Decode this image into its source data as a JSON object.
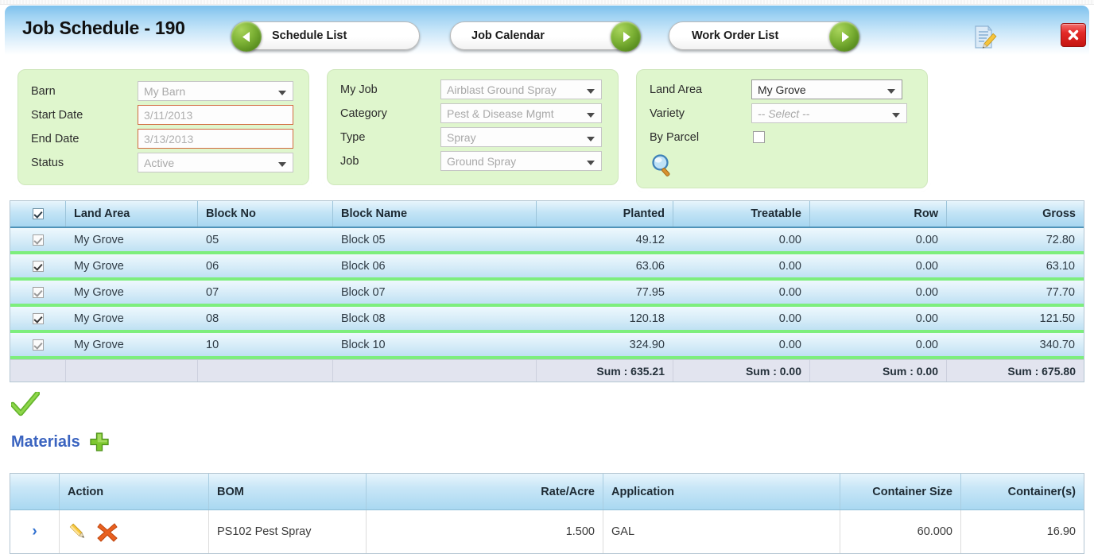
{
  "header": {
    "title": "Job Schedule - 190",
    "nav_buttons": [
      {
        "label": "Schedule List",
        "arrow": "left-arrow-icon"
      },
      {
        "label": "Job Calendar",
        "arrow": "right-arrow-icon"
      },
      {
        "label": "Work Order List",
        "arrow": "right-arrow-icon"
      }
    ],
    "edit_note_icon": "document-pencil-icon",
    "close_icon": "close-x-icon",
    "accent_blue": "#9bd0f2",
    "close_red": "#e32a27"
  },
  "filters": {
    "panel_left": {
      "rows": [
        {
          "label": "Barn",
          "value": "My Barn",
          "control": "select"
        },
        {
          "label": "Start Date",
          "value": "3/11/2013",
          "control": "date"
        },
        {
          "label": "End Date",
          "value": "3/13/2013",
          "control": "date"
        },
        {
          "label": "Status",
          "value": "Active",
          "control": "select"
        }
      ]
    },
    "panel_middle": {
      "rows": [
        {
          "label": "My Job",
          "value": "Airblast Ground Spray",
          "control": "select"
        },
        {
          "label": "Category",
          "value": "Pest & Disease Mgmt",
          "control": "select"
        },
        {
          "label": "Type",
          "value": "Spray",
          "control": "select"
        },
        {
          "label": "Job",
          "value": "Ground Spray",
          "control": "select"
        }
      ]
    },
    "panel_right": {
      "rows": [
        {
          "label": "Land Area",
          "value": "My Grove",
          "control": "select"
        },
        {
          "label": "Variety",
          "value": "-- Select --",
          "control": "select"
        },
        {
          "label": "By Parcel",
          "value": "",
          "control": "checkbox"
        }
      ],
      "search_icon": "magnifier-icon"
    },
    "panel_bg": "#dff6cd"
  },
  "blocks_grid": {
    "columns": [
      "",
      "Land Area",
      "Block No",
      "Block Name",
      "Planted",
      "Treatable",
      "Row",
      "Gross"
    ],
    "rows": [
      {
        "checked": true,
        "land_area": "My Grove",
        "block_no": "05",
        "block_name": "Block 05",
        "planted": "49.12",
        "treatable": "0.00",
        "row": "0.00",
        "gross": "72.80"
      },
      {
        "checked": true,
        "land_area": "My Grove",
        "block_no": "06",
        "block_name": "Block 06",
        "planted": "63.06",
        "treatable": "0.00",
        "row": "0.00",
        "gross": "63.10"
      },
      {
        "checked": true,
        "land_area": "My Grove",
        "block_no": "07",
        "block_name": "Block 07",
        "planted": "77.95",
        "treatable": "0.00",
        "row": "0.00",
        "gross": "77.70"
      },
      {
        "checked": true,
        "land_area": "My Grove",
        "block_no": "08",
        "block_name": "Block 08",
        "planted": "120.18",
        "treatable": "0.00",
        "row": "0.00",
        "gross": "121.50"
      },
      {
        "checked": true,
        "land_area": "My Grove",
        "block_no": "10",
        "block_name": "Block 10",
        "planted": "324.90",
        "treatable": "0.00",
        "row": "0.00",
        "gross": "340.70"
      }
    ],
    "summary": {
      "planted": "Sum : 635.21",
      "treatable": "Sum : 0.00",
      "row": "Sum : 0.00",
      "gross": "Sum : 675.80"
    },
    "row_separator_color": "#7dee7d"
  },
  "confirm_check_icon": "green-check-icon",
  "materials": {
    "title": "Materials",
    "add_icon": "green-plus-icon",
    "columns": [
      "",
      "Action",
      "BOM",
      "Rate/Acre",
      "Application",
      "Container Size",
      "Container(s)"
    ],
    "rows": [
      {
        "expand": "›",
        "edit_icon": "pencil-icon",
        "delete_icon": "red-x-icon",
        "bom": "PS102 Pest Spray",
        "rate_acre": "1.500",
        "application": "GAL",
        "container_size": "60.000",
        "containers": "16.90"
      }
    ]
  }
}
